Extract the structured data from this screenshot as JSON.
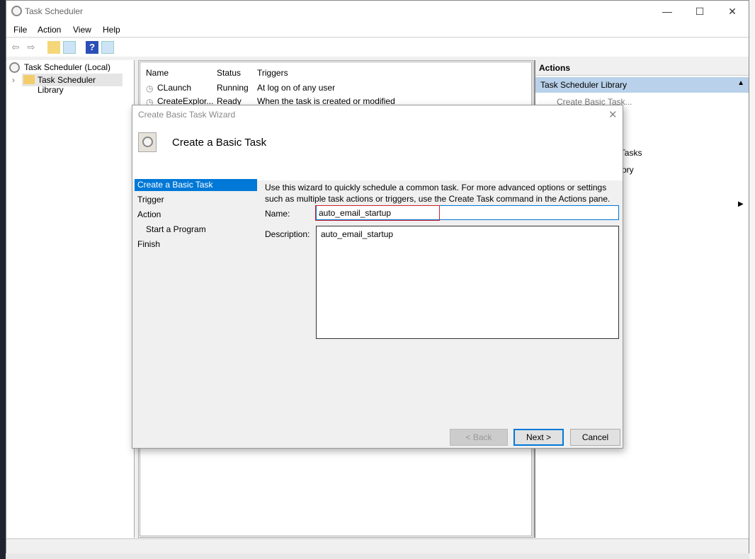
{
  "window": {
    "title": "Task Scheduler",
    "minimize": "—",
    "maximize": "☐",
    "close": "✕"
  },
  "menu": [
    "File",
    "Action",
    "View",
    "Help"
  ],
  "toolbar": {
    "icons": [
      "back-arrow-icon",
      "forward-arrow-icon",
      "folder-up-icon",
      "show-hide-console-tree-icon",
      "help-icon",
      "show-hide-action-pane-icon"
    ]
  },
  "tree": {
    "root": "Task Scheduler (Local)",
    "child": "Task Scheduler Library"
  },
  "tasks": {
    "columns": [
      "Name",
      "Status",
      "Triggers"
    ],
    "rows": [
      {
        "name": "CLaunch",
        "status": "Running",
        "trigger": "At log on of any user"
      },
      {
        "name": "CreateExplor...",
        "status": "Ready",
        "trigger": "When the task is created or modified"
      }
    ]
  },
  "actions": {
    "title": "Actions",
    "section": "Task Scheduler Library",
    "items": [
      "Create Basic Task...",
      "g Tasks",
      "istory"
    ]
  },
  "dialog": {
    "title": "Create Basic Task Wizard",
    "heading": "Create a Basic Task",
    "steps": [
      "Create a Basic Task",
      "Trigger",
      "Action",
      "Start a Program",
      "Finish"
    ],
    "active_step": "Create a Basic Task",
    "intro": "Use this wizard to quickly schedule a common task.  For more advanced options or settings such as multiple task actions or triggers, use the Create Task command in the Actions pane.",
    "name_label": "Name:",
    "name_value": "auto_email_startup",
    "description_label": "Description:",
    "description_value": "auto_email_startup",
    "back": "< Back",
    "next": "Next >",
    "cancel": "Cancel"
  },
  "colors": {
    "selection": "#0078d7",
    "actions_header": "#b9d1ea",
    "highlight_box": "#d0202a"
  }
}
